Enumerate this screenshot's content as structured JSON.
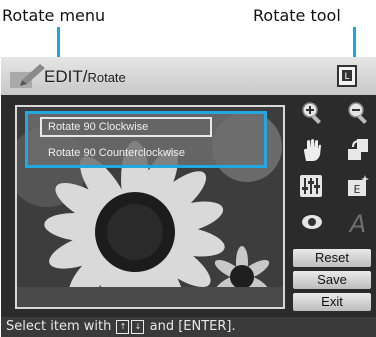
{
  "callouts": {
    "rotate_menu": "Rotate menu",
    "rotate_tool": "Rotate tool"
  },
  "header": {
    "title": "EDIT",
    "subtitle": "Rotate"
  },
  "menu": {
    "items": [
      {
        "label": "Rotate 90 Clockwise",
        "selected": true
      },
      {
        "label": "Rotate 90 Counterclockwise",
        "selected": false
      }
    ]
  },
  "tools": [
    {
      "icon": "zoom-in-icon"
    },
    {
      "icon": "zoom-out-icon"
    },
    {
      "icon": "hand-icon"
    },
    {
      "icon": "rotate-icon"
    },
    {
      "icon": "adjust-icon"
    },
    {
      "icon": "effect-icon"
    },
    {
      "icon": "red-eye-icon"
    },
    {
      "icon": "text-icon"
    }
  ],
  "buttons": {
    "reset": "Reset",
    "save": "Save",
    "exit": "Exit"
  },
  "status": {
    "prefix": "Select item with",
    "key_up": "↑",
    "key_down": "↓",
    "suffix": "and [ENTER]."
  },
  "colors": {
    "highlight": "#22a8de"
  }
}
